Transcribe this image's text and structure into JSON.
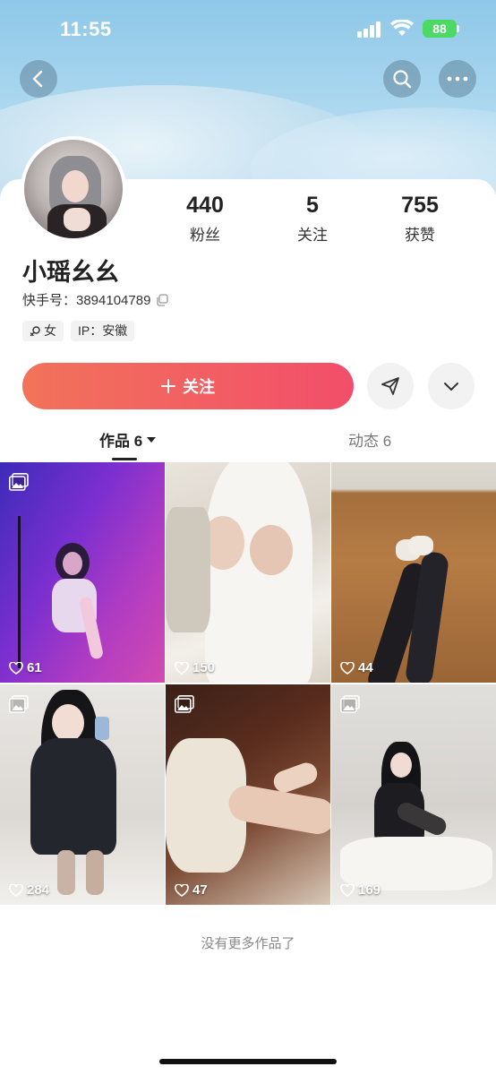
{
  "status_bar": {
    "time": "11:55",
    "battery": "88"
  },
  "header": {
    "back_icon": "chevron-left-icon",
    "search_icon": "search-icon",
    "more_icon": "more-dots-icon"
  },
  "profile": {
    "name": "小瑶幺幺",
    "uid_label": "快手号：3894104789",
    "tags": [
      {
        "label": "女",
        "icon": "female-icon"
      },
      {
        "label": "IP：安徽"
      }
    ],
    "stats": [
      {
        "value": "440",
        "label": "粉丝"
      },
      {
        "value": "5",
        "label": "关注"
      },
      {
        "value": "755",
        "label": "获赞"
      }
    ]
  },
  "actions": {
    "follow_label": "关注",
    "share_icon": "send-icon",
    "expand_icon": "chevron-down-icon"
  },
  "tabs": [
    {
      "label": "作品 6",
      "active": true
    },
    {
      "label": "动态 6",
      "active": false
    }
  ],
  "posts": [
    {
      "likes": "61",
      "gallery": true
    },
    {
      "likes": "150",
      "gallery": false
    },
    {
      "likes": "44",
      "gallery": false
    },
    {
      "likes": "284",
      "gallery": true
    },
    {
      "likes": "47",
      "gallery": true
    },
    {
      "likes": "169",
      "gallery": true
    }
  ],
  "footer": {
    "end_text": "没有更多作品了"
  },
  "colors": {
    "accent_start": "#f2735a",
    "accent_end": "#f24e6a",
    "battery": "#4cd964"
  }
}
